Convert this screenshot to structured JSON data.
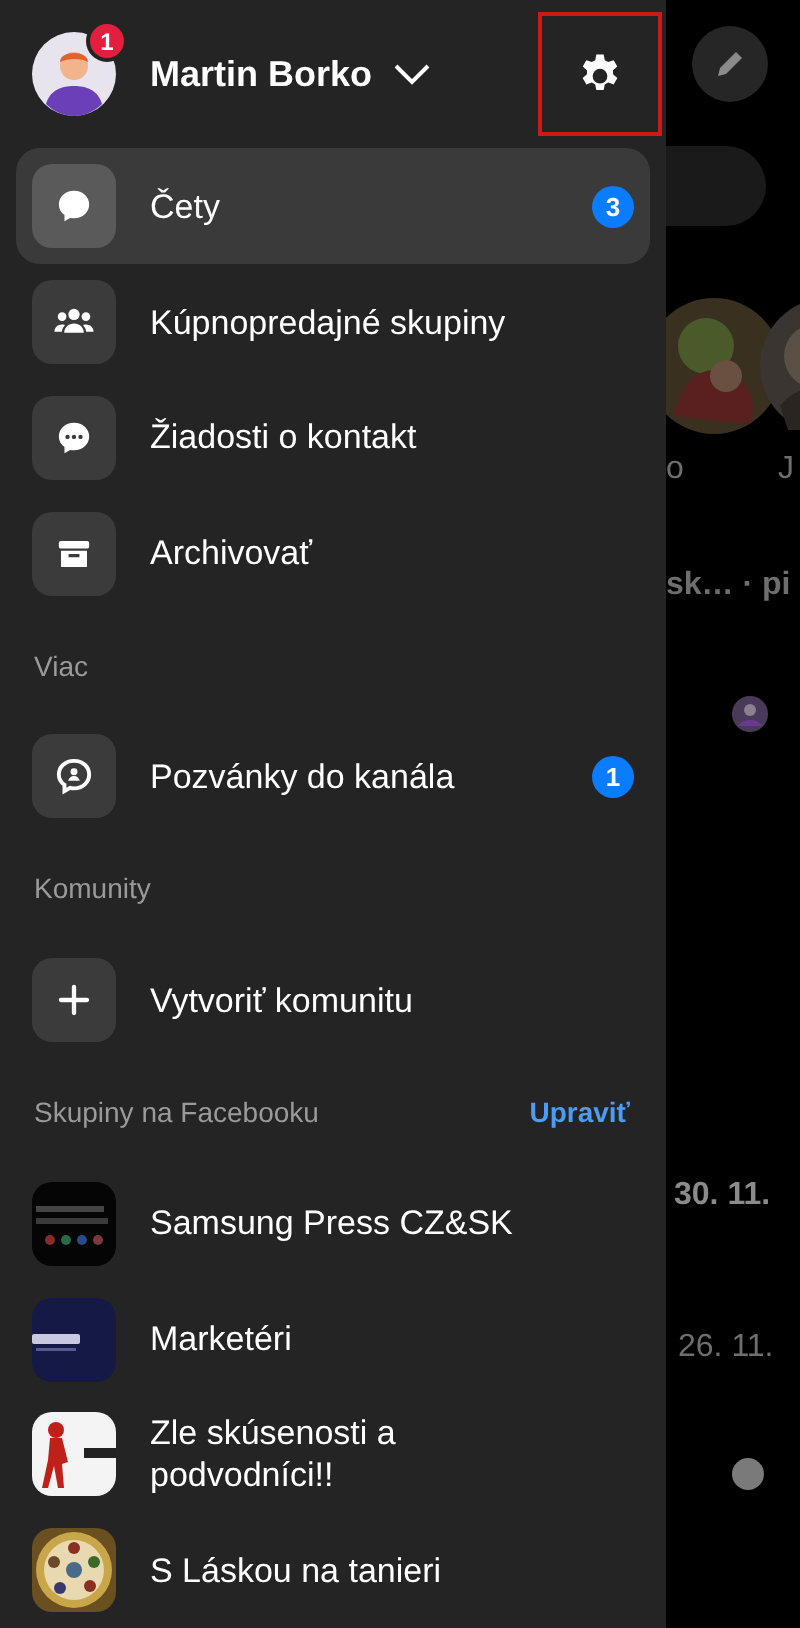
{
  "profile": {
    "name": "Martin Borko",
    "badge": "1"
  },
  "menu": [
    {
      "label": "Čety",
      "selected": true,
      "badge": "3"
    },
    {
      "label": "Kúpnopredajné skupiny",
      "selected": false
    },
    {
      "label": "Žiadosti o kontakt",
      "selected": false
    },
    {
      "label": "Archivovať",
      "selected": false
    }
  ],
  "sections": [
    {
      "title": "Viac",
      "items": [
        {
          "label": "Pozvánky do kanála",
          "selected": false,
          "badge": "1"
        }
      ]
    },
    {
      "title": "Komunity",
      "items": [
        {
          "label": "Vytvoriť komunitu",
          "selected": false
        }
      ]
    }
  ],
  "groups": {
    "title": "Skupiny na Facebooku",
    "action": "Upraviť",
    "items": [
      {
        "label": "Samsung Press CZ&SK"
      },
      {
        "label": "Marketéri"
      },
      {
        "label": "Zle skúsenosti a podvodníci!!"
      },
      {
        "label": "S Láskou na tanieri"
      }
    ]
  },
  "background": {
    "story_labels": [
      "o",
      "J"
    ],
    "preview": "sk…  · pi",
    "dates": [
      "30. 11.",
      "26. 11."
    ]
  }
}
